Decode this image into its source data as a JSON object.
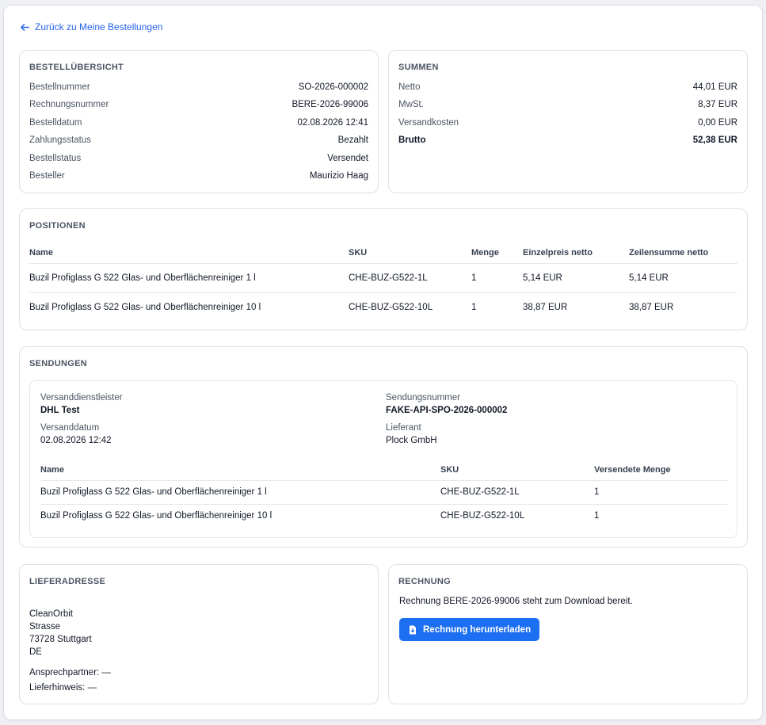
{
  "nav": {
    "back_label": "Zurück zu Meine Bestellungen"
  },
  "overview": {
    "title": "BESTELLÜBERSICHT",
    "rows": [
      {
        "label": "Bestellnummer",
        "value": "SO-2026-000002"
      },
      {
        "label": "Rechnungsnummer",
        "value": "BERE-2026-99006"
      },
      {
        "label": "Bestelldatum",
        "value": "02.08.2026 12:41"
      },
      {
        "label": "Zahlungsstatus",
        "value": "Bezahlt"
      },
      {
        "label": "Bestellstatus",
        "value": "Versendet"
      },
      {
        "label": "Besteller",
        "value": "Maurizio Haag"
      }
    ]
  },
  "totals": {
    "title": "SUMMEN",
    "rows": [
      {
        "label": "Netto",
        "value": "44,01 EUR"
      },
      {
        "label": "MwSt.",
        "value": "8,37 EUR"
      },
      {
        "label": "Versandkosten",
        "value": "0,00 EUR"
      },
      {
        "label": "Brutto",
        "value": "52,38 EUR"
      }
    ]
  },
  "positions": {
    "title": "POSITIONEN",
    "headers": [
      "Name",
      "SKU",
      "Menge",
      "Einzelpreis netto",
      "Zeilensumme netto"
    ],
    "rows": [
      [
        "Buzil Profiglass G 522 Glas- und Oberflächenreiniger 1 l",
        "CHE-BUZ-G522-1L",
        "1",
        "5,14 EUR",
        "5,14 EUR"
      ],
      [
        "Buzil Profiglass G 522 Glas- und Oberflächenreiniger 10 l",
        "CHE-BUZ-G522-10L",
        "1",
        "38,87 EUR",
        "38,87 EUR"
      ]
    ]
  },
  "shipments": {
    "title": "SENDUNGEN",
    "carrier_label": "Versanddienstleister",
    "carrier": "DHL Test",
    "tracking_label": "Sendungsnummer",
    "tracking": "FAKE-API-SPO-2026-000002",
    "date_label": "Versanddatum",
    "date": "02.08.2026 12:42",
    "supplier_label": "Lieferant",
    "supplier": "Plock GmbH",
    "headers": [
      "Name",
      "SKU",
      "Versendete Menge"
    ],
    "rows": [
      [
        "Buzil Profiglass G 522 Glas- und Oberflächenreiniger 1 l",
        "CHE-BUZ-G522-1L",
        "1"
      ],
      [
        "Buzil Profiglass G 522 Glas- und Oberflächenreiniger 10 l",
        "CHE-BUZ-G522-10L",
        "1"
      ]
    ]
  },
  "address": {
    "title": "LIEFERADRESSE",
    "lines": [
      "CleanOrbit",
      "Strasse",
      "73728 Stuttgart",
      "DE"
    ],
    "contact": "Ansprechpartner: —",
    "note": "Lieferhinweis: —"
  },
  "invoice": {
    "title": "RECHNUNG",
    "text": "Rechnung BERE-2026-99006 steht zum Download bereit.",
    "button_label": "Rechnung herunterladen",
    "button_color": "#1d6ff2"
  },
  "icons": {
    "back": "arrow-left-icon",
    "download": "file-download-icon"
  },
  "colors": {
    "accent": "#2563eb",
    "border": "#dcdfe4"
  }
}
